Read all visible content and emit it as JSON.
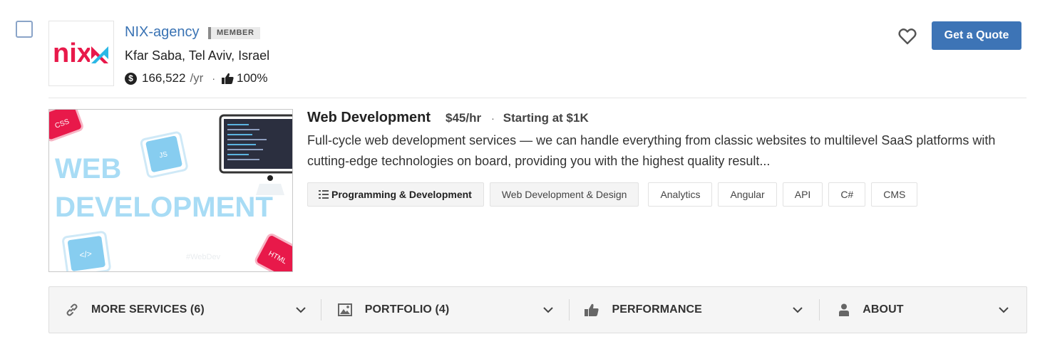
{
  "company": {
    "name": "NIX-agency",
    "badge": "MEMBER",
    "location": "Kfar Saba, Tel Aviv, Israel",
    "logo_text": "nix",
    "revenue": "166,522",
    "revenue_unit": "/yr",
    "rating": "100%"
  },
  "actions": {
    "quote_label": "Get a Quote",
    "favorite_icon": "heart-icon"
  },
  "service": {
    "title": "Web Development",
    "rate": "$45/hr",
    "min_project": "Starting at $1K",
    "description": "Full-cycle web development services — we can handle everything from classic websites to multilevel SaaS platforms with cutting-edge technologies on board, providing you with the highest quality result...",
    "image": {
      "line1": "WEB",
      "line2": "DEVELOPMENT",
      "css": "CSS",
      "js": "JS",
      "html": "HTML",
      "code": "</>",
      "hashtag": "#WebDev"
    },
    "tags": {
      "category": "Programming & Development",
      "subcategory": "Web Development & Design",
      "items": [
        "Analytics",
        "Angular",
        "API",
        "C#",
        "CMS"
      ]
    }
  },
  "bottom_bar": {
    "more_services": "MORE SERVICES (6)",
    "portfolio": "PORTFOLIO (4)",
    "performance": "PERFORMANCE",
    "about": "ABOUT"
  },
  "colors": {
    "accent": "#3d74b6",
    "link": "#3a73b4",
    "logo_red": "#e8194a",
    "logo_cyan": "#2bb8e6",
    "image_blue": "#a8dcf5"
  }
}
